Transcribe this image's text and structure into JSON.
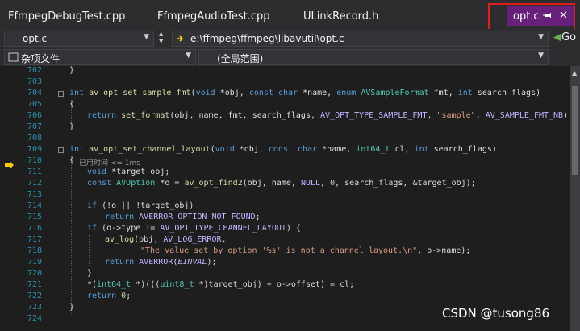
{
  "tabs": {
    "items": [
      {
        "label": "FfmpegDebugTest.cpp"
      },
      {
        "label": "FfmpegAudioTest.cpp"
      },
      {
        "label": "ULinkRecord.h"
      }
    ],
    "active": {
      "label": "opt.c"
    }
  },
  "nav": {
    "file_combo": "opt.c",
    "path_combo": "e:\\ffmpeg\\ffmpeg\\libavutil\\opt.c",
    "go_label": "Go",
    "project_combo": "杂项文件",
    "scope_combo": "(全局范围)"
  },
  "editor": {
    "line_numbers": [
      "702",
      "703",
      "704",
      "705",
      "706",
      "707",
      "708",
      "709",
      "710",
      "711",
      "712",
      "713",
      "714",
      "715",
      "716",
      "717",
      "718",
      "719",
      "720",
      "721",
      "722",
      "723",
      "724"
    ],
    "hint_text": "已用时间 <= 1ms"
  },
  "watermark": "CSDN @tusong86",
  "colors": {
    "accent": "#68217a",
    "highlight_box": "#e01e1e",
    "breakpoint_arrow": "#ffcc00"
  }
}
